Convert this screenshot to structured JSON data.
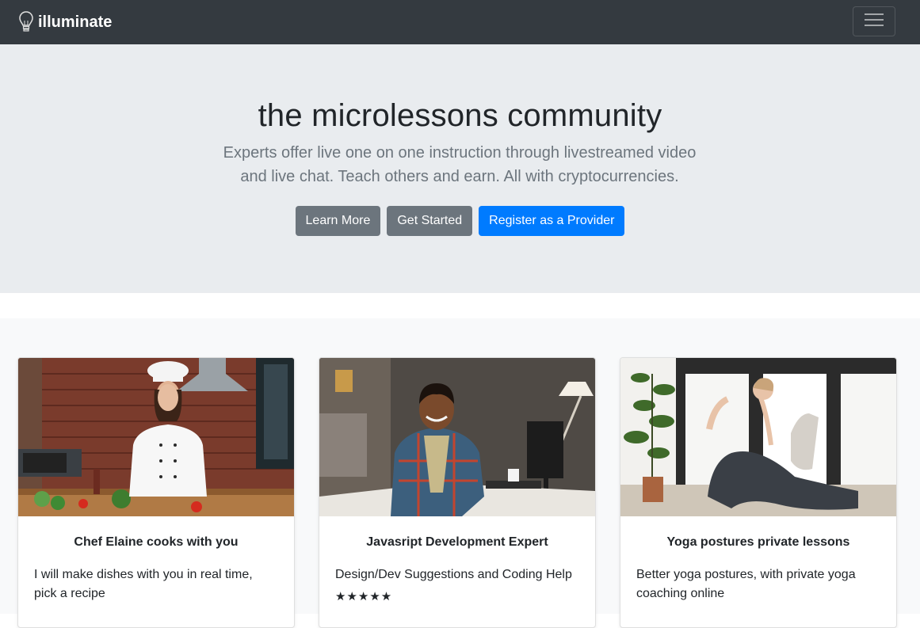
{
  "navbar": {
    "brand": "illuminate",
    "brand_icon": "lightbulb-icon",
    "toggler_icon": "hamburger-menu-icon"
  },
  "hero": {
    "title": "the microlessons community",
    "lead": "Experts offer live one on one instruction through livestreamed video and live chat. Teach others and earn. All with cryptocurrencies.",
    "buttons": {
      "learn_more": "Learn More",
      "get_started": "Get Started",
      "register": "Register as a Provider"
    }
  },
  "cards": [
    {
      "title": "Chef Elaine cooks with you",
      "text": "I will make dishes with you in real time, pick a recipe",
      "image": "chef-photo"
    },
    {
      "title": "Javasript Development Expert",
      "text": "Design/Dev Suggestions and Coding Help",
      "rating": "★★★★★",
      "image": "developer-photo"
    },
    {
      "title": "Yoga postures private lessons",
      "text": "Better yoga postures, with private yoga coaching online",
      "image": "yoga-photo"
    }
  ],
  "colors": {
    "navbar": "#343a40",
    "hero": "#e9ecef",
    "primary": "#007bff",
    "secondary": "#6c757d"
  }
}
